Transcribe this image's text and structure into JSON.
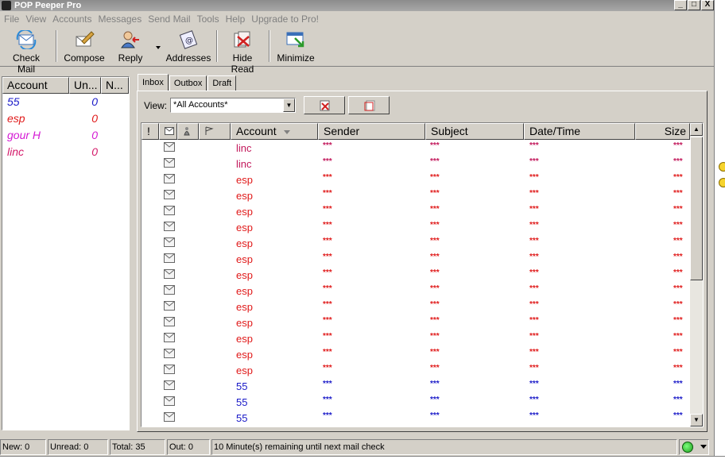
{
  "window": {
    "title": "POP Peeper Pro",
    "minimize": "_",
    "maximize": "□",
    "close": "X"
  },
  "menu": [
    "File",
    "View",
    "Accounts",
    "Messages",
    "Send Mail",
    "Tools",
    "Help",
    "Upgrade to Pro!"
  ],
  "toolbar": {
    "check_mail": "Check Mail",
    "compose": "Compose",
    "reply": "Reply",
    "addresses": "Addresses",
    "hide_read": "Hide Read",
    "minimize": "Minimize"
  },
  "accounts_panel": {
    "headers": [
      "Account",
      "Un...",
      "N..."
    ],
    "rows": [
      {
        "name": "55",
        "unread": "0",
        "color": "#1a1ac8"
      },
      {
        "name": "esp",
        "unread": "0",
        "color": "#e01a1a"
      },
      {
        "name": "gour H",
        "unread": "0",
        "color": "#d41ad4"
      },
      {
        "name": "linc",
        "unread": "0",
        "color": "#d41a6a"
      }
    ]
  },
  "tabs": [
    "Inbox",
    "Outbox",
    "Draft"
  ],
  "view": {
    "label": "View:",
    "selected": "*All Accounts*"
  },
  "grid": {
    "headers": {
      "flag": "!",
      "account": "Account",
      "sender": "Sender",
      "subject": "Subject",
      "datetime": "Date/Time",
      "size": "Size"
    },
    "masked": "***",
    "rows": [
      {
        "account": "linc",
        "color": "#c2185b"
      },
      {
        "account": "linc",
        "color": "#c2185b"
      },
      {
        "account": "esp",
        "color": "#e01a1a"
      },
      {
        "account": "esp",
        "color": "#e01a1a"
      },
      {
        "account": "esp",
        "color": "#e01a1a"
      },
      {
        "account": "esp",
        "color": "#e01a1a"
      },
      {
        "account": "esp",
        "color": "#e01a1a"
      },
      {
        "account": "esp",
        "color": "#e01a1a"
      },
      {
        "account": "esp",
        "color": "#e01a1a"
      },
      {
        "account": "esp",
        "color": "#e01a1a"
      },
      {
        "account": "esp",
        "color": "#e01a1a"
      },
      {
        "account": "esp",
        "color": "#e01a1a"
      },
      {
        "account": "esp",
        "color": "#e01a1a"
      },
      {
        "account": "esp",
        "color": "#e01a1a"
      },
      {
        "account": "esp",
        "color": "#e01a1a"
      },
      {
        "account": "55",
        "color": "#1a1ac8"
      },
      {
        "account": "55",
        "color": "#1a1ac8"
      },
      {
        "account": "55",
        "color": "#1a1ac8"
      }
    ]
  },
  "status": {
    "new": "New: 0",
    "unread": "Unread: 0",
    "total": "Total: 35",
    "out": "Out: 0",
    "message": "10 Minute(s) remaining until next mail check"
  }
}
